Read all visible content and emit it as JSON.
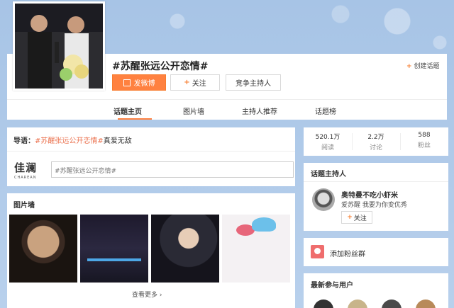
{
  "header": {
    "title": "#苏醒张远公开恋情#",
    "create_topic": "创建话题",
    "post_button": "发微博",
    "follow_button": "关注",
    "compete_host_button": "竞争主持人"
  },
  "tabs": [
    "话题主页",
    "图片墙",
    "主持人推荐",
    "话题榜"
  ],
  "intro": {
    "label": "导语：",
    "tag": "#苏醒张远公开恋情#",
    "text": "真爱无敌",
    "brand_cn": "佳澜",
    "brand_en": "CHAREAN",
    "compose_value": "#苏醒张远公开恋情#"
  },
  "photos": {
    "title": "图片墙",
    "see_more": "查看更多"
  },
  "stats": [
    {
      "num": "520.1万",
      "label": "阅读"
    },
    {
      "num": "2.2万",
      "label": "讨论"
    },
    {
      "num": "588",
      "label": "粉丝"
    }
  ],
  "host": {
    "title": "话题主持人",
    "name": "奥特曼不吃小虾米",
    "desc": "爱苏醒 我要为你变优秀",
    "follow": "关注"
  },
  "fans_group": "添加粉丝群",
  "recent_users_title": "最新参与用户",
  "colors": {
    "accent": "#ff8140",
    "link": "#eb7350"
  }
}
